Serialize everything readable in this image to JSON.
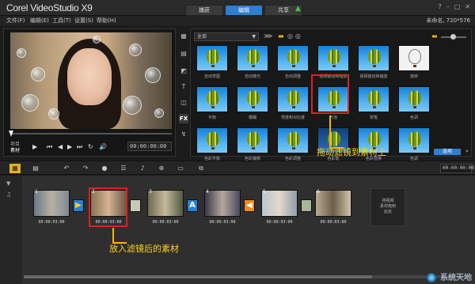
{
  "app": {
    "logo": "Corel VideoStudio X9",
    "tabs": [
      {
        "label": "捕获",
        "active": false
      },
      {
        "label": "编辑",
        "active": true
      },
      {
        "label": "共享",
        "active": false
      }
    ],
    "window_controls": [
      "?",
      "–",
      "□",
      "✕"
    ],
    "project_info": "未命名, 720*576"
  },
  "menu": [
    "文件(F)",
    "编辑(E)",
    "工具(T)",
    "设置(S)",
    "帮助(H)"
  ],
  "preview": {
    "project_label": "项目",
    "clip_label": "素材",
    "timecode": "00:00:00:00",
    "transport": [
      "▶",
      "⏮",
      "◀",
      "▶",
      "⏭",
      "↻",
      "🔊"
    ]
  },
  "library": {
    "tool_icons": [
      "media-icon",
      "instant-project-icon",
      "transition-icon",
      "title-icon",
      "graphic-icon",
      "fx-icon",
      "path-icon"
    ],
    "fx_label": "FX",
    "category": "全部",
    "filters": [
      {
        "name": "自动草图",
        "variant": "normal"
      },
      {
        "name": "自动曝光",
        "variant": "normal"
      },
      {
        "name": "自动调整",
        "variant": "normal"
      },
      {
        "name": "视频摇动和缩放",
        "variant": "normal"
      },
      {
        "name": "视频摇动和缩放",
        "variant": "normal"
      },
      {
        "name": "旋转",
        "variant": "white"
      },
      {
        "name": "平衡",
        "variant": "normal"
      },
      {
        "name": "模糊",
        "variant": "normal"
      },
      {
        "name": "亮度和对比度",
        "variant": "normal"
      },
      {
        "name": "气泡",
        "variant": "normal"
      },
      {
        "name": "炭笔",
        "variant": "normal"
      },
      {
        "name": "色调",
        "variant": "normal"
      },
      {
        "name": "色彩平衡",
        "variant": "normal"
      },
      {
        "name": "色彩偏移",
        "variant": "normal"
      },
      {
        "name": "色彩调整",
        "variant": "normal"
      },
      {
        "name": "色彩笔",
        "variant": "dark"
      },
      {
        "name": "色彩替换",
        "variant": "normal"
      },
      {
        "name": "色调",
        "variant": "normal"
      }
    ],
    "option_button": "选项"
  },
  "callouts": {
    "drag": "拖动滤镜到素材上",
    "after": "放入滤镜后的素材"
  },
  "timeline": {
    "timecode": "00:00:00:00",
    "clips": [
      {
        "num": "1",
        "duration": "00:00:03:00"
      },
      {
        "num": "2",
        "duration": "00:00:03:00"
      },
      {
        "num": "3",
        "duration": "00:00:03:00"
      },
      {
        "num": "4",
        "duration": "00:00:03:00"
      },
      {
        "num": "5",
        "duration": "00:00:03:00"
      },
      {
        "num": "6",
        "duration": "00:00:03:00"
      }
    ],
    "transitions": [
      "▶",
      "",
      "A",
      "◀",
      ""
    ],
    "drop_slot": "将视频\n素材拖到\n此处"
  },
  "watermark": "系统天地",
  "colors": {
    "accent": "#2d7fd0",
    "highlight": "#e02020",
    "callout": "#ffd21a",
    "toolbar_selected": "#e8b020"
  }
}
